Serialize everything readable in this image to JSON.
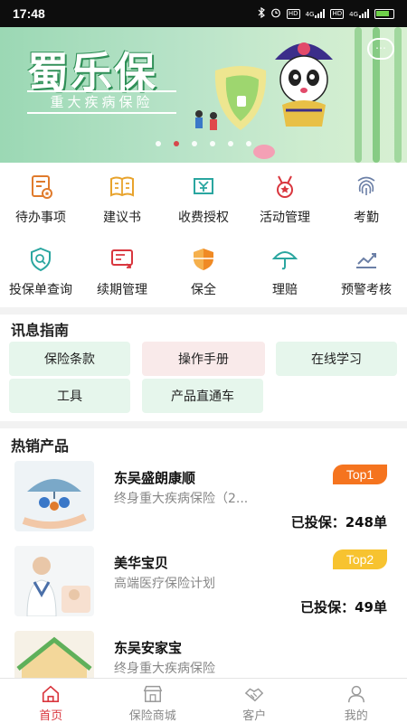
{
  "status": {
    "time": "17:48",
    "hd1": "HD",
    "hd2": "HD",
    "net1": "4G",
    "net2": "4G"
  },
  "banner": {
    "title": "蜀乐保",
    "subtitle": "重大疾病保险",
    "chat_icon": "chat-bubble-icon",
    "dots_count": 6,
    "active_dot": 1
  },
  "grid": {
    "items": [
      {
        "label": "待办事项",
        "icon": "todo-icon"
      },
      {
        "label": "建议书",
        "icon": "book-icon"
      },
      {
        "label": "收费授权",
        "icon": "payment-auth-icon"
      },
      {
        "label": "活动管理",
        "icon": "medal-icon"
      },
      {
        "label": "考勤",
        "icon": "fingerprint-icon"
      },
      {
        "label": "投保单查询",
        "icon": "search-doc-icon"
      },
      {
        "label": "续期管理",
        "icon": "renewal-icon"
      },
      {
        "label": "保全",
        "icon": "shield-icon"
      },
      {
        "label": "理赔",
        "icon": "umbrella-icon"
      },
      {
        "label": "预警考核",
        "icon": "trend-chart-icon"
      }
    ]
  },
  "guide": {
    "title": "讯息指南",
    "buttons": [
      "保险条款",
      "操作手册",
      "在线学习",
      "工具",
      "产品直通车"
    ]
  },
  "hot": {
    "title": "热销产品",
    "products": [
      {
        "name": "东吴盛朗康顺",
        "desc": "终身重大疾病保险（2...",
        "badge": "Top1",
        "sold": "已投保：248单"
      },
      {
        "name": "美华宝贝",
        "desc": "高端医疗保险计划",
        "badge": "Top2",
        "sold": "已投保：49单"
      },
      {
        "name": "东吴安家宝",
        "desc": "终身重大疾病保险",
        "badge": "",
        "sold": ""
      }
    ]
  },
  "tabbar": {
    "tabs": [
      {
        "label": "首页",
        "icon": "home-icon",
        "active": true
      },
      {
        "label": "保险商城",
        "icon": "store-icon",
        "active": false
      },
      {
        "label": "客户",
        "icon": "handshake-icon",
        "active": false
      },
      {
        "label": "我的",
        "icon": "person-icon",
        "active": false
      }
    ]
  },
  "colors": {
    "accent": "#d9363e",
    "top1": "#f5741f",
    "top2": "#f7c330",
    "guide_green": "#e6f6ec",
    "guide_pink": "#f9eaea"
  }
}
